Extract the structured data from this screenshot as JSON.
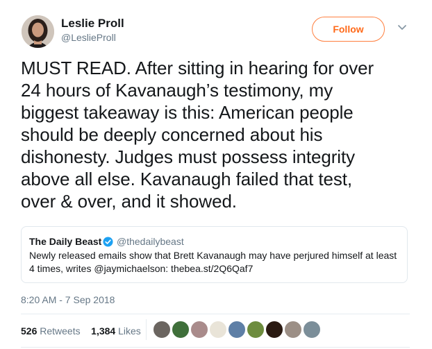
{
  "author": {
    "name": "Leslie Proll",
    "handle": "@LeslieProll"
  },
  "follow_label": "Follow",
  "tweet_text": "MUST READ. After sitting in hearing for over\n24 hours of Kavanaugh’s testimony, my\nbiggest takeaway is this: American people\nshould be deeply concerned about his\ndishonesty. Judges must possess integrity\nabove all else. Kavanaugh failed that test,\nover & over, and it showed.",
  "quoted": {
    "name": "The Daily Beast",
    "handle": "@thedailybeast",
    "text": "Newly released emails show that Brett Kavanaugh may have perjured himself at least 4 times, writes @jaymichaelson: thebea.st/2Q6Qaf7"
  },
  "timestamp": "8:20 AM - 7 Sep 2018",
  "stats": {
    "retweets_count": "526",
    "retweets_label": "Retweets",
    "likes_count": "1,384",
    "likes_label": "Likes"
  },
  "colors": {
    "follow_accent": "#ff6a1a",
    "verified": "#1da1f2",
    "secondary_text": "#657786"
  },
  "icons": [
    "chevron-down-icon",
    "verified-badge-icon"
  ]
}
